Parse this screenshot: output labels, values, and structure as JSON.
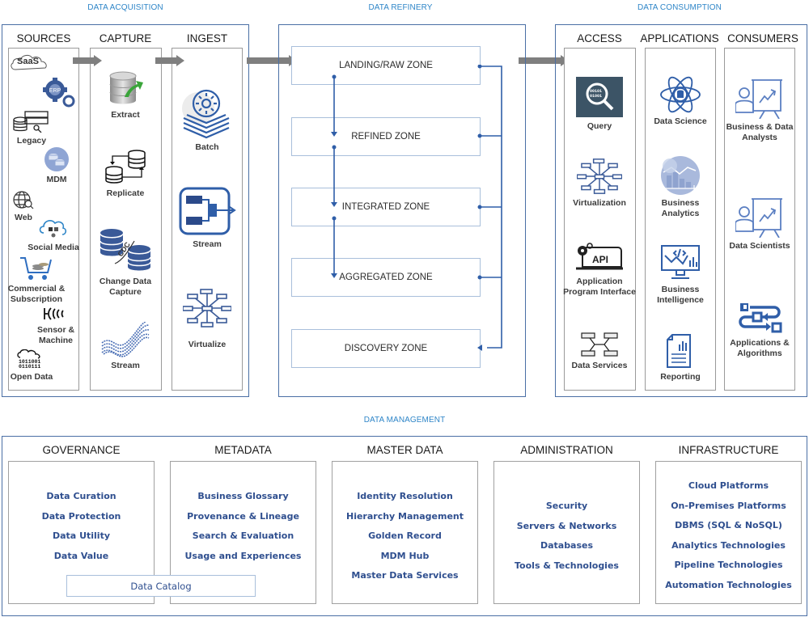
{
  "sections": {
    "acquisition": "DATA ACQUISITION",
    "refinery": "DATA REFINERY",
    "consumption": "DATA CONSUMPTION",
    "management": "DATA MANAGEMENT"
  },
  "acquisition": {
    "columns": [
      {
        "header": "SOURCES",
        "items": [
          {
            "label": "SaaS",
            "icon": "cloud-saas-icon"
          },
          {
            "label": "ERP",
            "icon": "erp-gear-icon"
          },
          {
            "label": "Legacy",
            "icon": "legacy-server-icon"
          },
          {
            "label": "MDM",
            "icon": "mdm-database-icon"
          },
          {
            "label": "Web",
            "icon": "globe-search-icon"
          },
          {
            "label": "Social Media",
            "icon": "social-cloud-icon"
          },
          {
            "label": "Commercial & Subscription",
            "icon": "cart-icon"
          },
          {
            "label": "Sensor & Machine",
            "icon": "sensor-icon"
          },
          {
            "label": "Open Data",
            "icon": "binary-cloud-icon"
          }
        ]
      },
      {
        "header": "CAPTURE",
        "items": [
          {
            "label": "Extract",
            "icon": "database-export-icon"
          },
          {
            "label": "Replicate",
            "icon": "database-replicate-icon"
          },
          {
            "label": "Change Data Capture",
            "icon": "cdc-icon"
          },
          {
            "label": "Stream",
            "icon": "data-wave-icon"
          }
        ]
      },
      {
        "header": "INGEST",
        "items": [
          {
            "label": "Batch",
            "icon": "batch-layers-icon"
          },
          {
            "label": "Stream",
            "icon": "stream-flow-icon"
          },
          {
            "label": "Virtualize",
            "icon": "virtualize-hub-icon"
          }
        ]
      }
    ]
  },
  "refinery": {
    "zones": [
      "LANDING/RAW ZONE",
      "REFINED ZONE",
      "INTEGRATED ZONE",
      "AGGREGATED ZONE",
      "DISCOVERY ZONE"
    ]
  },
  "consumption": {
    "columns": [
      {
        "header": "ACCESS",
        "items": [
          {
            "label": "Query",
            "icon": "query-magnifier-icon"
          },
          {
            "label": "Virtualization",
            "icon": "virtualize-hub-icon"
          },
          {
            "label": "Application Program Interface",
            "icon": "api-laptop-icon"
          },
          {
            "label": "Data Services",
            "icon": "data-services-icon"
          }
        ]
      },
      {
        "header": "APPLICATIONS",
        "items": [
          {
            "label": "Data Science",
            "icon": "atom-database-icon"
          },
          {
            "label": "Business Analytics",
            "icon": "analytics-chart-icon"
          },
          {
            "label": "Business Intelligence",
            "icon": "monitor-chart-icon"
          },
          {
            "label": "Reporting",
            "icon": "report-document-icon"
          }
        ]
      },
      {
        "header": "CONSUMERS",
        "items": [
          {
            "label": "Business & Data Analysts",
            "icon": "presenter-icon"
          },
          {
            "label": "Data Scientists",
            "icon": "presenter-icon"
          },
          {
            "label": "Applications & Algorithms",
            "icon": "workflow-icon"
          }
        ]
      }
    ]
  },
  "management": {
    "groups": [
      {
        "header": "GOVERNANCE",
        "items": [
          "Data Curation",
          "Data Protection",
          "Data Utility",
          "Data Value"
        ]
      },
      {
        "header": "METADATA",
        "items": [
          "Business Glossary",
          "Provenance & Lineage",
          "Search & Evaluation",
          "Usage and Experiences"
        ]
      },
      {
        "header": "MASTER DATA",
        "items": [
          "Identity Resolution",
          "Hierarchy Management",
          "Golden Record",
          "MDM Hub",
          "Master Data Services"
        ]
      },
      {
        "header": "ADMINISTRATION",
        "items": [
          "Security",
          "Servers & Networks",
          "Databases",
          "Tools & Technologies"
        ]
      },
      {
        "header": "INFRASTRUCTURE",
        "items": [
          "Cloud Platforms",
          "On-Premises Platforms",
          "DBMS (SQL & NoSQL)",
          "Analytics Technologies",
          "Pipeline Technologies",
          "Automation Technologies"
        ]
      }
    ],
    "catalog": "Data Catalog"
  },
  "colors": {
    "section_title": "#2f86c8",
    "frame": "#4a6fa5",
    "icon_blue": "#3a5a98",
    "arrow_gray": "#7f7f7f",
    "list_text": "#2f4f8f"
  }
}
